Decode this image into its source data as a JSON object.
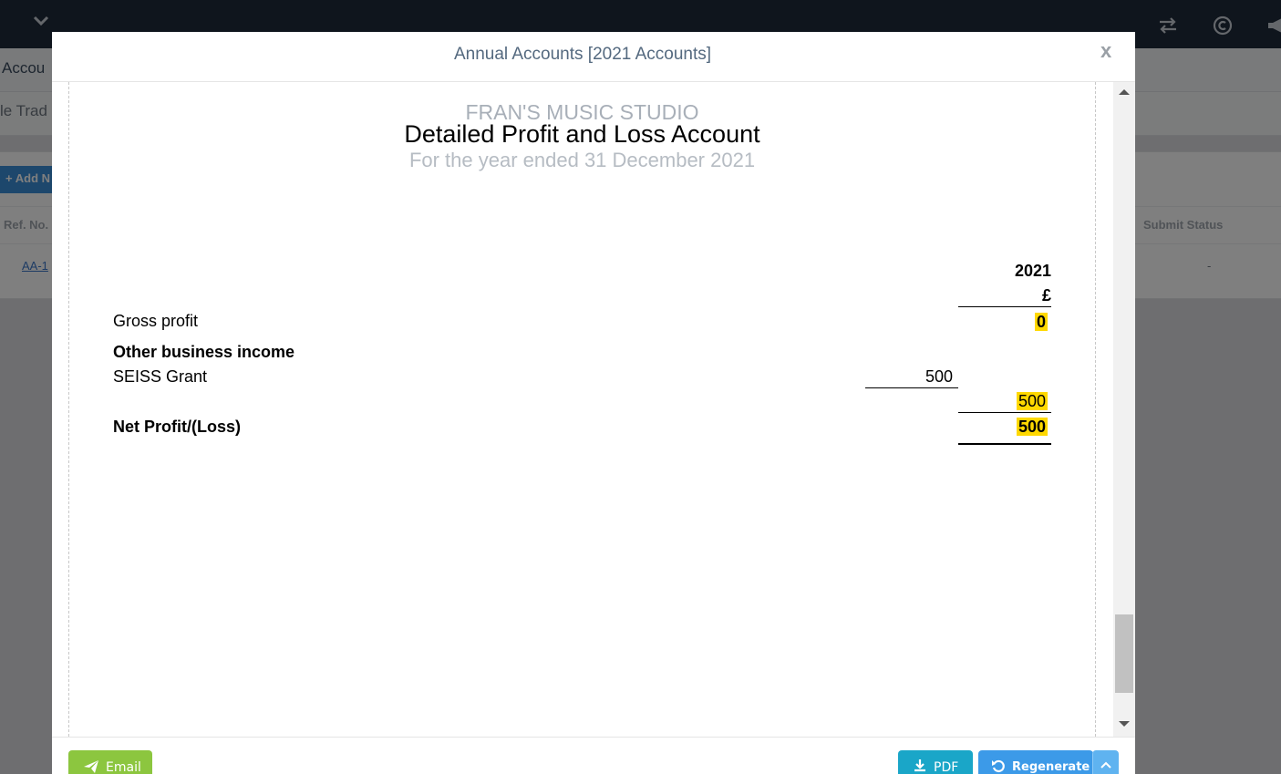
{
  "background": {
    "breadcrumb_fragment": "Accou",
    "tab_fragment": "le Trad",
    "add_button": "Add N",
    "column_ref": "Ref. No.",
    "column_submit_status": "Submit Status",
    "row_ref": "AA-1",
    "row_status": "-"
  },
  "modal": {
    "title": "Annual Accounts [2021 Accounts]",
    "close_label": "x"
  },
  "report": {
    "company": "FRAN'S MUSIC STUDIO",
    "title": "Detailed Profit and Loss Account",
    "period": "For the year ended 31 December 2021",
    "year_header": "2021",
    "currency_header": "£",
    "gross_profit_label": "Gross profit",
    "gross_profit_value": "0",
    "other_income_heading": "Other business income",
    "seiss_label": "SEISS Grant",
    "seiss_value": "500",
    "other_income_total": "500",
    "net_profit_label": "Net Profit/(Loss)",
    "net_profit_value": "500",
    "highlight_color": "#ffd800"
  },
  "footer": {
    "email_label": "Email",
    "pdf_label": "PDF",
    "regenerate_label": "Regenerate"
  },
  "colors": {
    "email_button": "#8cc63f",
    "pdf_button": "#1aa6c8",
    "regenerate_button": "#3c9ae8",
    "topbar": "#1e2a3a"
  }
}
